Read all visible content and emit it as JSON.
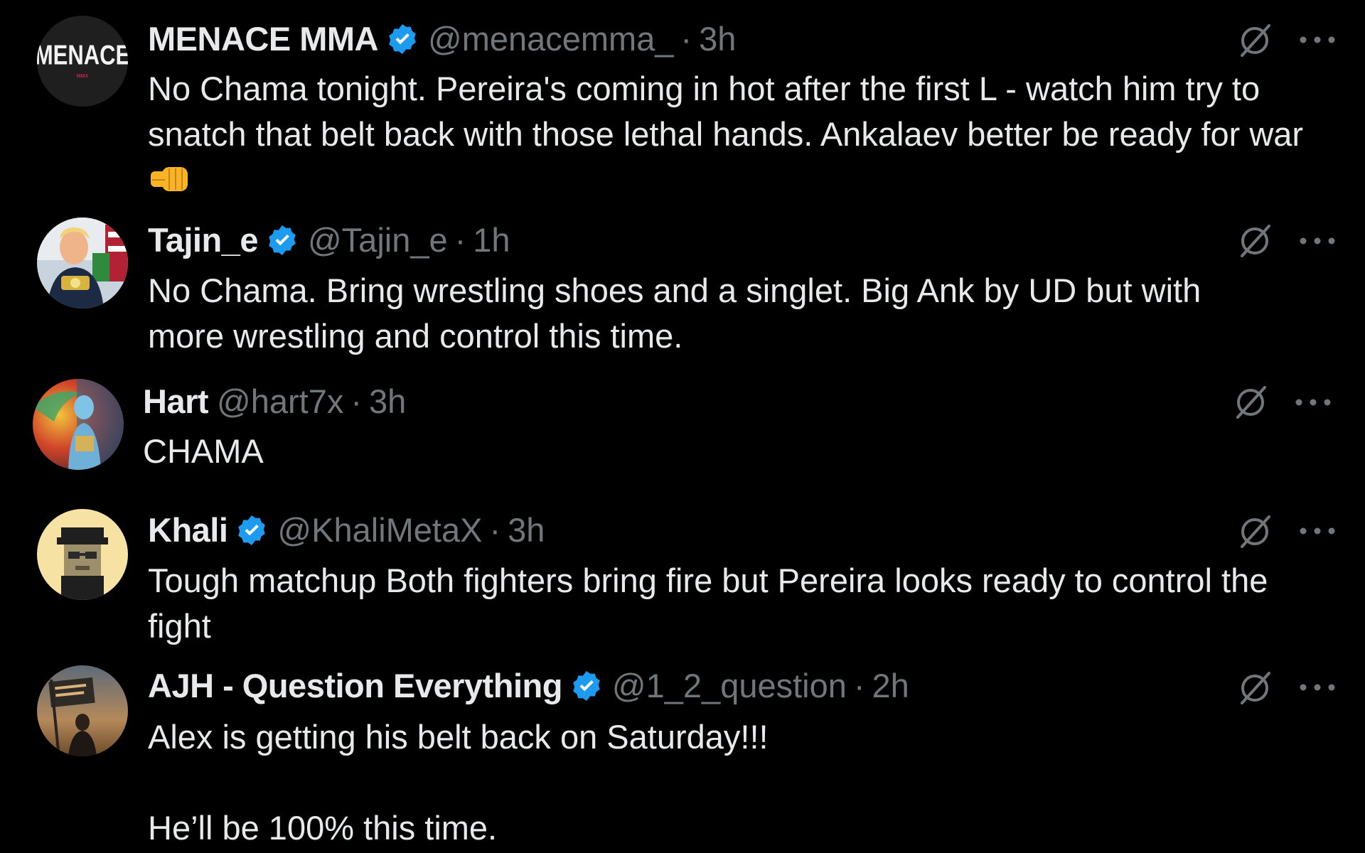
{
  "colors": {
    "background": "#000000",
    "text_primary": "#e7e9ea",
    "text_secondary": "#71767b",
    "verified_blue": "#1d9bf0"
  },
  "tweets": [
    {
      "name": "MENACE MMA",
      "verified": true,
      "handle": "@menacemma_",
      "separator": "·",
      "time": "3h",
      "body_lines": [
        "No Chama tonight. Pereira's coming in hot after the first L - watch him try to snatch that belt back with those lethal hands. Ankalaev better be ready for war"
      ],
      "emoji": "oncoming-fist-emoji",
      "avatar_text": "MENACE",
      "avatar_subtext": "MMA",
      "avatar_icon": "menace-mma-logo"
    },
    {
      "name": "Tajin_e",
      "verified": true,
      "handle": "@Tajin_e",
      "separator": "·",
      "time": "1h",
      "body_lines": [
        "No Chama. Bring wrestling shoes and a singlet. Big Ank by UD but with more wrestling and control this time."
      ],
      "avatar_icon": "person-with-belt-photo"
    },
    {
      "name": "Hart",
      "verified": false,
      "handle": "@hart7x",
      "separator": "·",
      "time": "3h",
      "body_lines": [
        "CHAMA"
      ],
      "avatar_icon": "surreal-figure-artwork"
    },
    {
      "name": "Khali",
      "verified": true,
      "handle": "@KhaliMetaX",
      "separator": "·",
      "time": "3h",
      "body_lines": [
        "Tough matchup Both fighters bring fire but Pereira looks ready to control the fight"
      ],
      "avatar_icon": "pixel-character-with-hat"
    },
    {
      "name": "AJH - Question Everything",
      "verified": true,
      "handle": "@1_2_question",
      "separator": "·",
      "time": "2h",
      "body_lines": [
        "Alex is getting his belt back on Saturday!!!",
        "",
        "He’ll be 100% this time."
      ],
      "avatar_icon": "person-holding-flag-photo"
    }
  ],
  "icons": {
    "grok": "grok-slash-circle-icon",
    "more": "more-options-ellipsis-icon"
  }
}
